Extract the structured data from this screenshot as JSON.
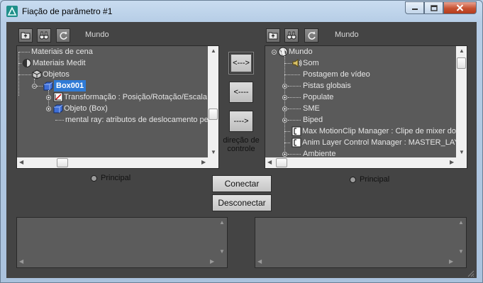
{
  "window": {
    "title": "Fiação de parâmetro #1"
  },
  "left_panel": {
    "label": "Mundo",
    "tree": [
      {
        "label": "Materiais de cena"
      },
      {
        "label": "Materiais Medit"
      },
      {
        "label": "Objetos"
      },
      {
        "label": "Box001",
        "selected": true
      },
      {
        "label": "Transformação : Posição/Rotação/Escala"
      },
      {
        "label": "Objeto (Box)"
      },
      {
        "label": "mental ray: atributos de deslocamento pe"
      }
    ],
    "radio_label": "Principal"
  },
  "right_panel": {
    "label": "Mundo",
    "tree": [
      {
        "label": "Mundo"
      },
      {
        "label": "Som"
      },
      {
        "label": "Postagem de vídeo"
      },
      {
        "label": "Pistas globais"
      },
      {
        "label": "Populate"
      },
      {
        "label": "SME"
      },
      {
        "label": "Biped"
      },
      {
        "label": "Max MotionClip Manager : Clipe de mixer do m"
      },
      {
        "label": "Anim Layer Control Manager : MASTER_LAYE"
      },
      {
        "label": "Ambiente"
      }
    ],
    "radio_label": "Principal"
  },
  "center": {
    "both_dir_label": "<--->",
    "left_dir_label": "<----",
    "right_dir_label": "---->",
    "caption_line1": "direção de",
    "caption_line2": "controle"
  },
  "buttons": {
    "connect": "Conectar",
    "disconnect": "Desconectar"
  },
  "colors": {
    "client_bg": "#444444",
    "panel_bg": "#5a5a5a",
    "selection": "#2f7bd6",
    "close": "#c75232"
  }
}
